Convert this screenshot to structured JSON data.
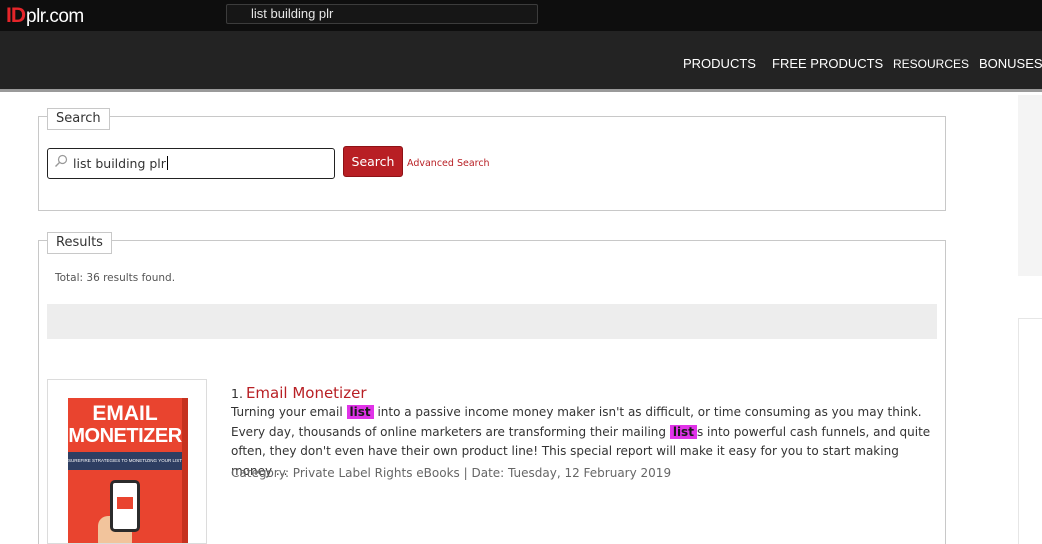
{
  "header": {
    "logo_id": "ID",
    "logo_plr": "plr.com",
    "top_search_value": "list building plr"
  },
  "nav": {
    "items": [
      "PRODUCTS",
      "FREE PRODUCTS",
      "RESOURCES",
      "BONUSES"
    ]
  },
  "search": {
    "legend": "Search",
    "input_value": "list building plr",
    "button_label": "Search",
    "advanced_link": "Advanced Search"
  },
  "results": {
    "legend": "Results",
    "total_text": "Total: 36 results found.",
    "items": [
      {
        "number": "1.",
        "title": "Email Monetizer",
        "desc_part1": "Turning your email ",
        "highlight1": "list",
        "desc_part2": " into a passive income money maker isn't as difficult, or time consuming as you may think. Every day, thousands of online marketers are transforming their mailing ",
        "highlight2": "list",
        "desc_part3": "s into powerful cash funnels, and quite often, they don't even have their own product line! This special report will make it easy for you to start making money ...",
        "meta": "Category: Private Label Rights eBooks | Date: Tuesday, 12 February 2019",
        "cover_line1": "EMAIL",
        "cover_line2": "MONETIZER",
        "cover_band": "SUREFIRE STRATEGIES TO MONETIZING YOUR LIST"
      }
    ]
  },
  "colors": {
    "accent": "#b81f24",
    "highlight": "#e033e8",
    "topbar": "#0e0e0e",
    "navbar": "#232323"
  }
}
